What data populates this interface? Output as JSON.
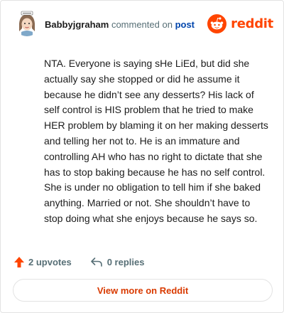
{
  "header": {
    "author": "Babbyjgraham",
    "commented_text": "commented on",
    "post_link": "post",
    "logo_text": "reddit"
  },
  "comment": {
    "body": "NTA. Everyone is saying sHe LiEd, but did she actually say she stopped or did he assume it because he didn’t see any desserts? His lack of self control is HIS problem that he tried to make HER problem by blaming it on her making desserts and telling her not to. He is an immature and controlling AH who has no right to dictate that she has to stop baking because he has no self control. She is under no obligation to tell him if she baked anything. Married or not. She shouldn’t have to stop doing what she enjoys because he says so."
  },
  "actions": {
    "upvotes": "2 upvotes",
    "replies": "0 replies"
  },
  "view_more": "View more on Reddit",
  "colors": {
    "brand": "#ff4500",
    "link": "#0045ac",
    "button_text": "#d93a00"
  },
  "icons": [
    "avatar-illustration",
    "reddit-snoo-icon",
    "upvote-arrow-icon",
    "reply-arrow-icon"
  ]
}
